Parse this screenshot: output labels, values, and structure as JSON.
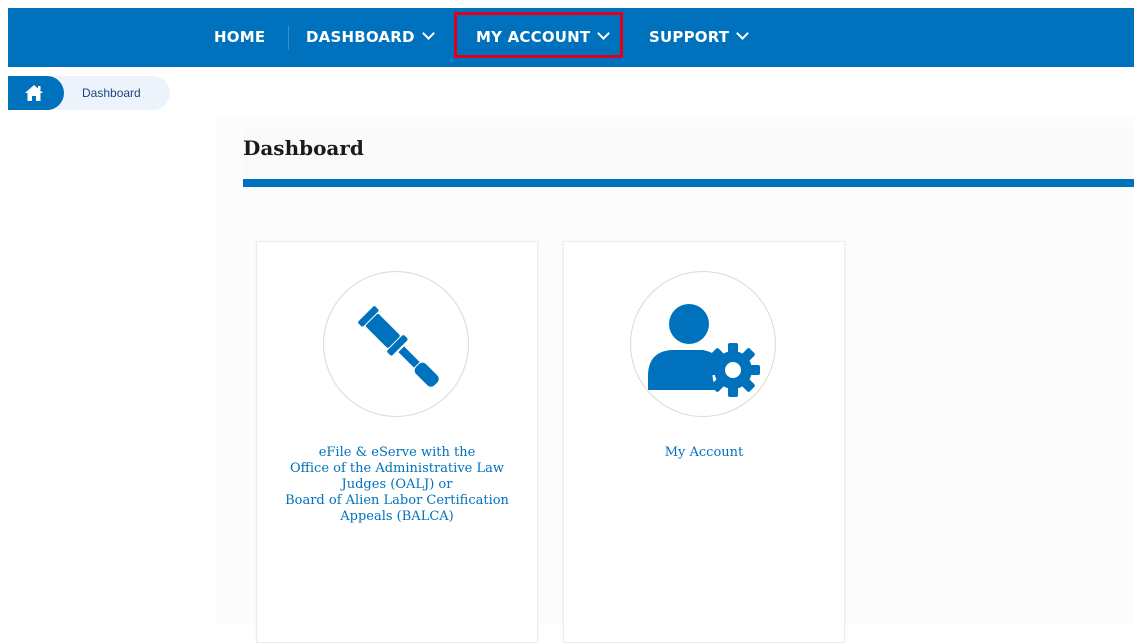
{
  "nav": {
    "home_label": "HOME",
    "dashboard_label": "DASHBOARD",
    "myaccount_label": "MY ACCOUNT",
    "support_label": "SUPPORT"
  },
  "breadcrumb": {
    "home_icon": "home-icon",
    "current": "Dashboard"
  },
  "page": {
    "title": "Dashboard"
  },
  "cards": [
    {
      "icon": "gavel-icon",
      "lines": [
        "eFile & eServe with the",
        "Office of the Administrative Law",
        "Judges (OALJ) or",
        "Board of Alien Labor Certification",
        "Appeals (BALCA)"
      ]
    },
    {
      "icon": "user-settings-icon",
      "lines": [
        "My Account"
      ]
    }
  ],
  "colors": {
    "brand_blue": "#0071bc",
    "highlight_red": "#e1001a",
    "breadcrumb_bg": "#edf3fa"
  }
}
